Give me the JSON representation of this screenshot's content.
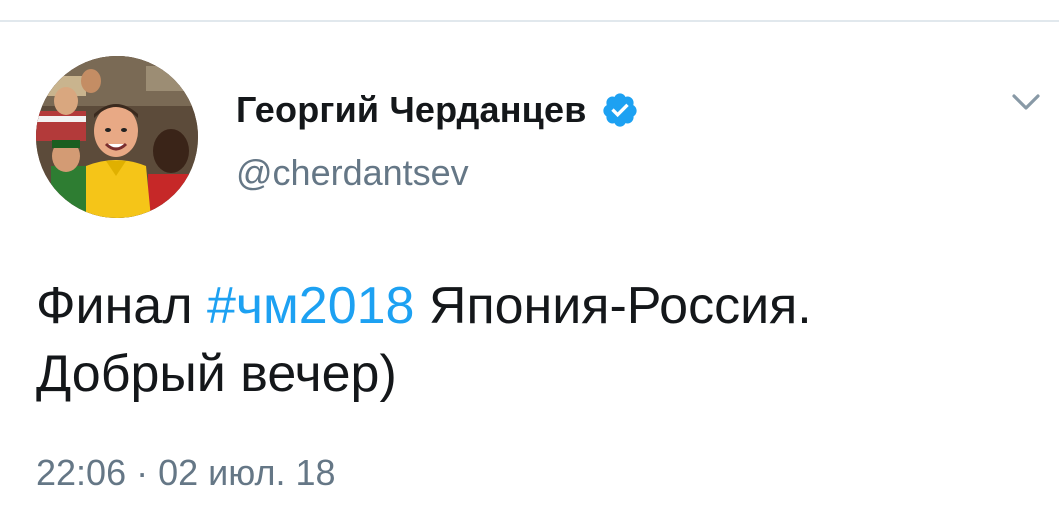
{
  "tweet": {
    "author": {
      "display_name": "Георгий Черданцев",
      "handle": "@cherdantsev",
      "verified": true
    },
    "text": {
      "prefix": "Финал ",
      "hashtag": "#чм2018",
      "after_hashtag": " Япония-Россия.",
      "second_line": "Добрый вечер)"
    },
    "timestamp": {
      "time": "22:06",
      "separator": " · ",
      "date": "02 июл. 18"
    }
  },
  "icons": {
    "verified": "verified-badge-icon",
    "menu": "chevron-down-icon"
  },
  "colors": {
    "text_primary": "#14171a",
    "text_secondary": "#657786",
    "link": "#1da1f2",
    "verified_badge": "#1da1f2",
    "divider": "#e1e8ed"
  }
}
